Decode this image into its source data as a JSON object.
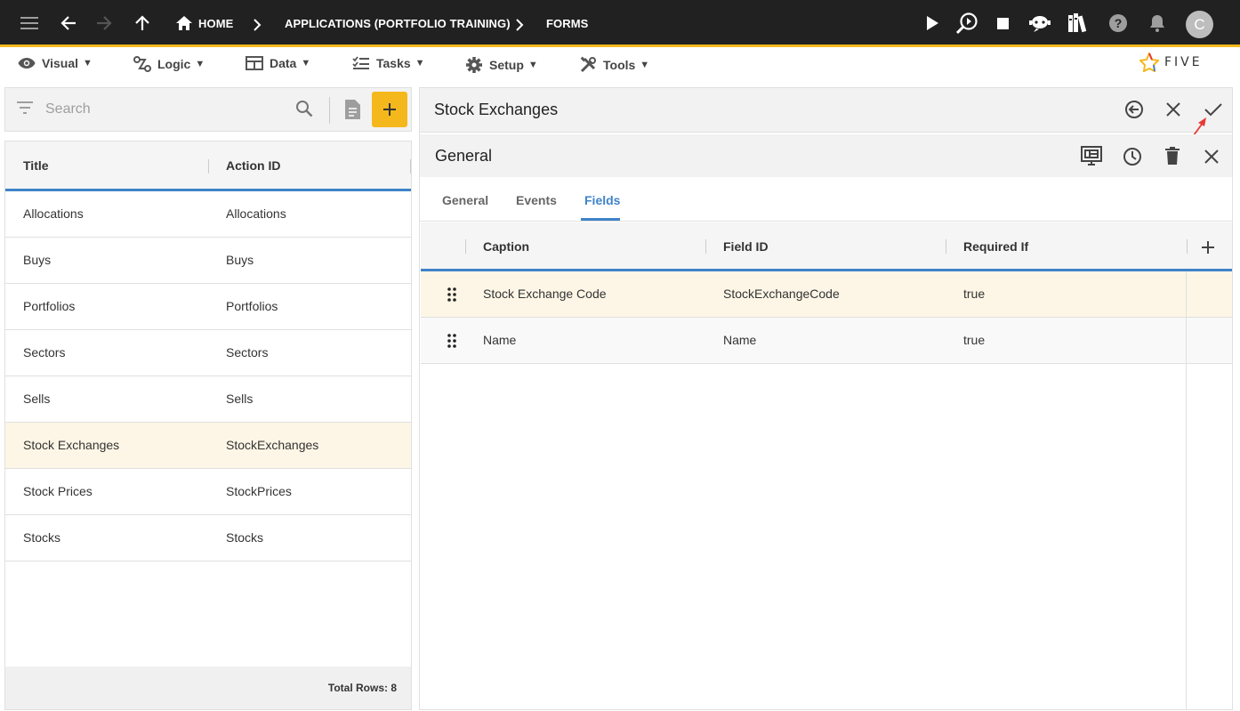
{
  "topbar": {
    "breadcrumbs": [
      "HOME",
      "APPLICATIONS (PORTFOLIO TRAINING)",
      "FORMS"
    ],
    "avatar": "C",
    "accent": "#f5b81c"
  },
  "menubar": {
    "items": [
      {
        "label": "Visual",
        "icon": "eye-icon"
      },
      {
        "label": "Logic",
        "icon": "logic-icon"
      },
      {
        "label": "Data",
        "icon": "table-icon"
      },
      {
        "label": "Tasks",
        "icon": "tasks-icon"
      },
      {
        "label": "Setup",
        "icon": "gear-icon"
      },
      {
        "label": "Tools",
        "icon": "tools-icon"
      }
    ],
    "logo": "FIVE"
  },
  "left": {
    "search_placeholder": "Search",
    "columns": [
      "Title",
      "Action ID"
    ],
    "rows": [
      {
        "title": "Allocations",
        "action": "Allocations"
      },
      {
        "title": "Buys",
        "action": "Buys"
      },
      {
        "title": "Portfolios",
        "action": "Portfolios"
      },
      {
        "title": "Sectors",
        "action": "Sectors"
      },
      {
        "title": "Sells",
        "action": "Sells"
      },
      {
        "title": "Stock Exchanges",
        "action": "StockExchanges"
      },
      {
        "title": "Stock Prices",
        "action": "StockPrices"
      },
      {
        "title": "Stocks",
        "action": "Stocks"
      }
    ],
    "selected_index": 5,
    "total_rows": "Total Rows: 8"
  },
  "right": {
    "title": "Stock Exchanges",
    "subtitle": "General",
    "tabs": [
      "General",
      "Events",
      "Fields"
    ],
    "active_tab": "Fields",
    "columns": [
      "Caption",
      "Field ID",
      "Required If"
    ],
    "rows": [
      {
        "caption": "Stock Exchange Code",
        "field_id": "StockExchangeCode",
        "required_if": "true"
      },
      {
        "caption": "Name",
        "field_id": "Name",
        "required_if": "true"
      }
    ]
  }
}
